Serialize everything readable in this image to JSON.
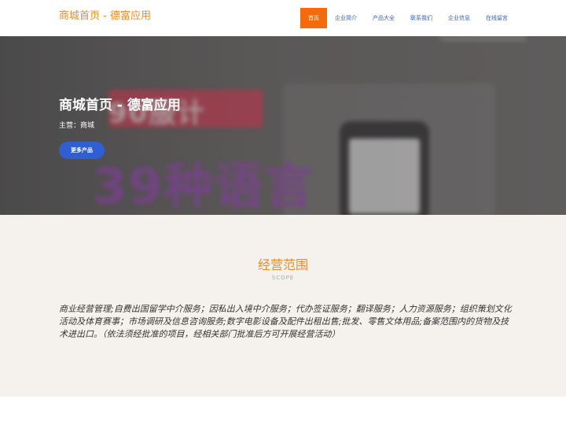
{
  "header": {
    "brand": "商城首页 - 德富应用",
    "nav": [
      {
        "label": "首页",
        "active": true
      },
      {
        "label": "企业简介",
        "active": false
      },
      {
        "label": "产品大全",
        "active": false
      },
      {
        "label": "联系我们",
        "active": false
      },
      {
        "label": "企业信息",
        "active": false
      },
      {
        "label": "在线留言",
        "active": false
      }
    ]
  },
  "hero": {
    "title": "商城首页 - 德富应用",
    "subtitle": "主营：商城",
    "button_label": "更多产品",
    "background_text_1": "90服计",
    "background_text_2": "39种语言"
  },
  "scope": {
    "title": "经营范围",
    "subtitle": "SCOPE",
    "body": "商业经营管理;自费出国留学中介服务；因私出入境中介服务；代办签证服务；翻译服务；人力资源服务；组织策划文化活动及体育赛事；市场调研及信息咨询服务;数字电影设备及配件出租出售;批发、零售文体用品;备案范围内的货物及技术进出口。（依法须经批准的项目，经相关部门批准后方可开展经营活动）"
  },
  "colors": {
    "accent_orange": "#f08a24",
    "active_nav_bg": "#f56b0b",
    "nav_link": "#2f5fb5",
    "button_blue": "#2f5fd0",
    "section_bg": "#f5f2ee"
  }
}
